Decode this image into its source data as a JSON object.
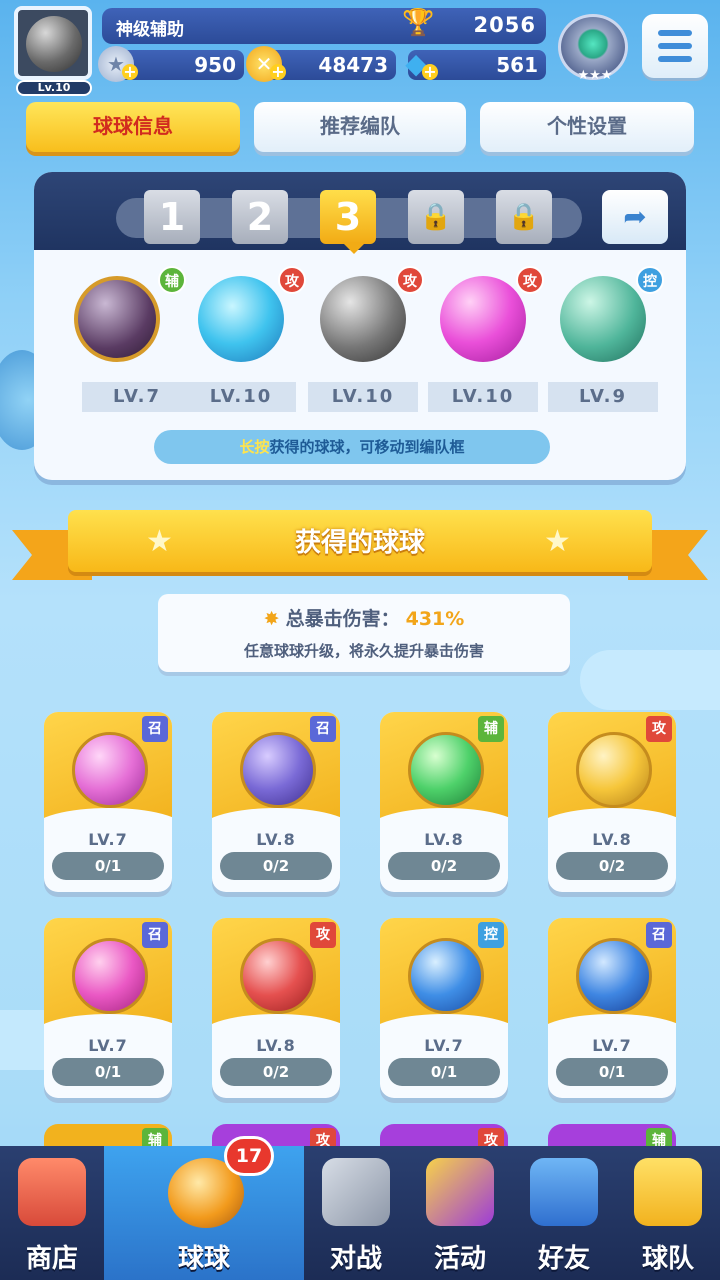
{
  "player": {
    "name": "神级辅助",
    "level": "Lv.10",
    "trophies": "2056"
  },
  "resources": {
    "energy": "950",
    "gold": "48473",
    "gems": "561"
  },
  "tabs": [
    {
      "label": "球球信息"
    },
    {
      "label": "推荐编队"
    },
    {
      "label": "个性设置"
    }
  ],
  "team": {
    "slots": [
      "1",
      "2",
      "3"
    ],
    "balls": [
      {
        "tag": "辅",
        "level": "LV.7"
      },
      {
        "tag": "攻",
        "level": "LV.10"
      },
      {
        "tag": "攻",
        "level": "LV.10"
      },
      {
        "tag": "攻",
        "level": "LV.10"
      },
      {
        "tag": "控",
        "level": "LV.9"
      }
    ],
    "hint_highlight": "长按",
    "hint_text": "获得的球球，可移动到编队框"
  },
  "section_title": "获得的球球",
  "crit": {
    "label": "总暴击伤害：",
    "value": "431%",
    "desc": "任意球球升级，将永久提升暴击伤害"
  },
  "owned_balls": [
    {
      "tag": "召",
      "level": "LV.7",
      "progress": "0/1"
    },
    {
      "tag": "召",
      "level": "LV.8",
      "progress": "0/2"
    },
    {
      "tag": "辅",
      "level": "LV.8",
      "progress": "0/2"
    },
    {
      "tag": "攻",
      "level": "LV.8",
      "progress": "0/2"
    },
    {
      "tag": "召",
      "level": "LV.7",
      "progress": "0/1"
    },
    {
      "tag": "攻",
      "level": "LV.8",
      "progress": "0/2"
    },
    {
      "tag": "控",
      "level": "LV.7",
      "progress": "0/1"
    },
    {
      "tag": "召",
      "level": "LV.7",
      "progress": "0/1"
    }
  ],
  "peek_tags": [
    "辅",
    "攻",
    "攻",
    "辅"
  ],
  "nav": [
    {
      "label": "商店"
    },
    {
      "label": "球球",
      "badge": "17"
    },
    {
      "label": "对战"
    },
    {
      "label": "活动"
    },
    {
      "label": "好友"
    },
    {
      "label": "球队"
    }
  ],
  "colors": {
    "tag_attack": "#e0483a",
    "tag_support": "#5cb53b",
    "tag_summon": "#5a68d8",
    "tag_control": "#3ea0e0",
    "accent_yellow": "#f8be1c"
  }
}
